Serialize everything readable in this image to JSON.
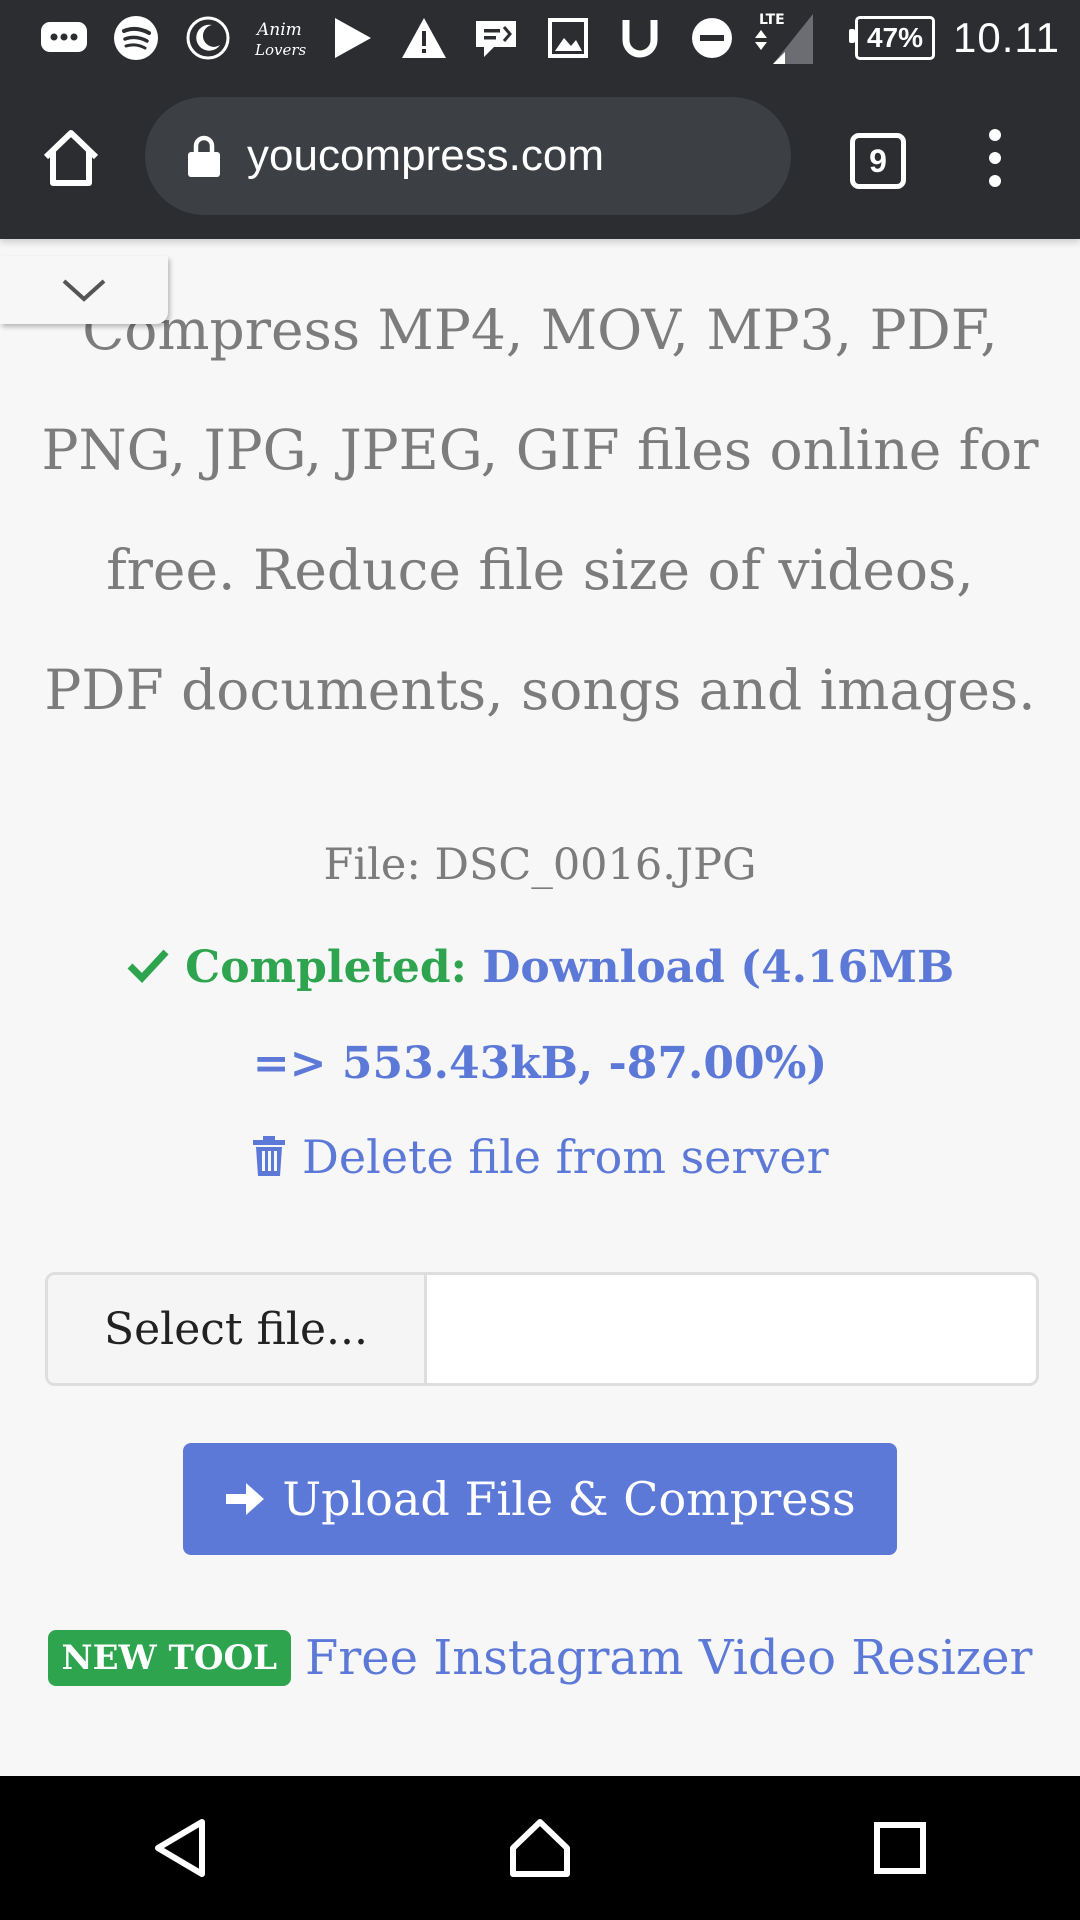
{
  "status_bar": {
    "icons": [
      "message-icon",
      "spotify-icon",
      "moon-icon",
      "anim-lovers-icon",
      "play-icon",
      "warning-icon",
      "chat-icon",
      "image-icon",
      "u-icon",
      "dnd-icon"
    ],
    "network": "LTE",
    "battery": "47%",
    "time": "10.11"
  },
  "browser": {
    "url": "youcompress.com",
    "tab_count": "9"
  },
  "page": {
    "description": "Compress MP4, MOV, MP3, PDF, PNG, JPG, JPEG, GIF files online for free. Reduce file size of videos, PDF documents, songs and images.",
    "file_label": "File: DSC_0016.JPG",
    "completed_label": "Completed:",
    "download_text": "Download (4.16MB => 553.43kB, -87.00%)",
    "delete_text": "Delete file from server",
    "select_file_label": "Select file...",
    "upload_button_label": "Upload File & Compress",
    "new_tool_badge": "NEW TOOL",
    "new_tool_link": "Free Instagram Video Resizer"
  },
  "colors": {
    "accent_blue": "#5c79d8",
    "success_green": "#2ea44f",
    "chrome_dark": "#2b2d31"
  }
}
